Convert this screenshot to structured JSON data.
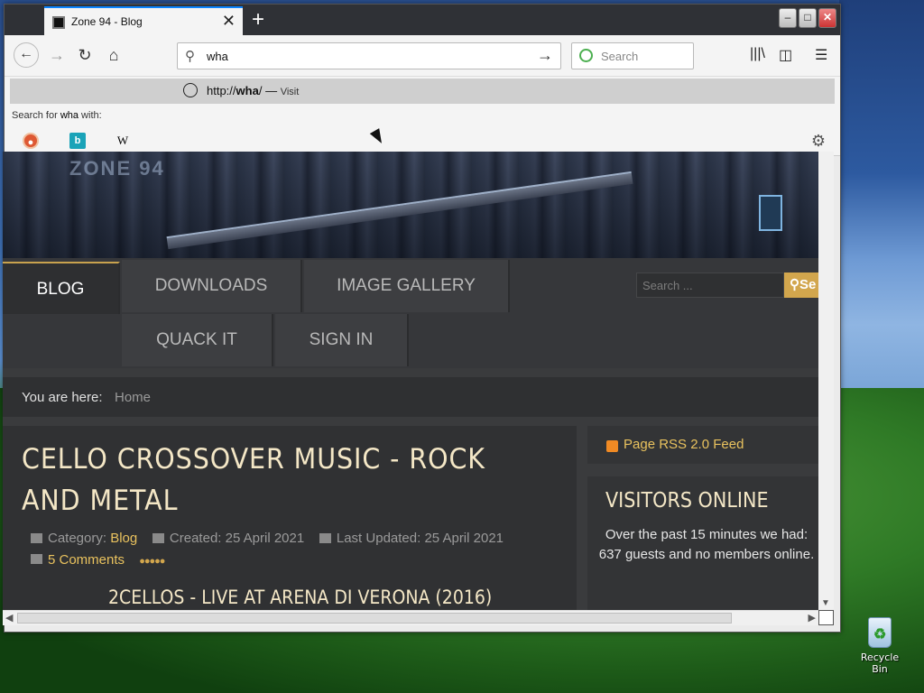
{
  "desktop": {
    "recycle_bin_label": "Recycle Bin"
  },
  "browser": {
    "tab_title": "Zone 94 - Blog",
    "tab_close": "✕",
    "new_tab": "+",
    "window_controls": {
      "minimize": "–",
      "maximize": "□",
      "close": "✕"
    },
    "nav": {
      "back": "←",
      "forward": "→",
      "reload": "↻",
      "home": "⌂"
    },
    "url_value": "wha",
    "search_placeholder": "Search",
    "dropdown": {
      "suggestion_prefix": "http://",
      "suggestion_bold": "wha",
      "suggestion_suffix": "/",
      "suggestion_separator": " — ",
      "visit_label": "Visit",
      "search_with_prefix": "Search for ",
      "search_with_term": "wha",
      "search_with_suffix": " with:",
      "engines": [
        "DuckDuckGo",
        "Bing",
        "Wikipedia"
      ],
      "engine_glyphs": [
        "●",
        "b",
        "W"
      ]
    }
  },
  "site": {
    "logo_text": "ZONE 94",
    "menu": [
      {
        "label": "BLOG",
        "active": true
      },
      {
        "label": "DOWNLOADS"
      },
      {
        "label": "IMAGE GALLERY"
      },
      {
        "label": "QUACK IT"
      },
      {
        "label": "SIGN IN"
      }
    ],
    "search_placeholder": "Search ...",
    "search_button": "Se",
    "breadcrumb_label": "You are here:",
    "breadcrumb_home": "Home",
    "article": {
      "title": "CELLO CROSSOVER MUSIC - ROCK AND METAL",
      "category_label": "Category:",
      "category_value": "Blog",
      "created": "Created: 25 April 2021",
      "updated": "Last Updated: 25 April 2021",
      "comments": "5 Comments",
      "rating_stars": 5,
      "subheading": "2CELLOS - LIVE AT ARENA DI VERONA (2016)"
    },
    "sidebar": {
      "rss_label": "Page RSS 2.0 Feed",
      "visitors_heading": "VISITORS ONLINE",
      "visitors_text": "Over the past 15 minutes we had:",
      "visitors_count": "637 guests and no members online."
    }
  },
  "colors": {
    "accent": "#0a84ff",
    "gold": "#e9c25e",
    "title": "#f4e7c6"
  }
}
